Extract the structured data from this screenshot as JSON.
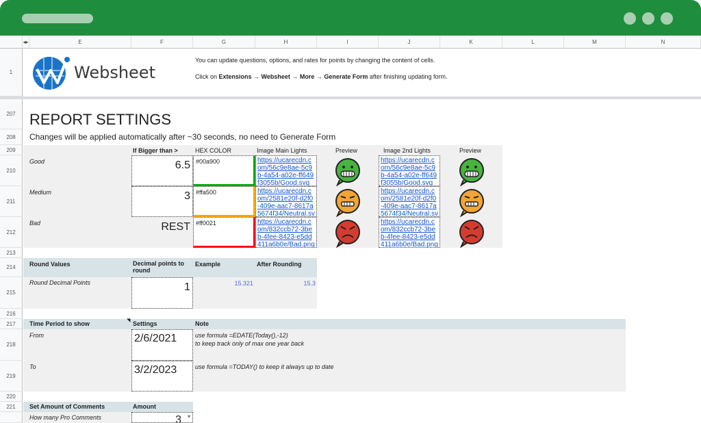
{
  "columns": [
    "E",
    "F",
    "G",
    "H",
    "I",
    "J",
    "K",
    "L",
    "M",
    "N"
  ],
  "rows": [
    "1",
    "207",
    "208",
    "209",
    "210",
    "211",
    "212",
    "213",
    "214",
    "215",
    "216",
    "217",
    "218",
    "219",
    "220",
    "221"
  ],
  "brand": "Websheet",
  "info": {
    "line1": "You can update questions, options, and rates for points by changing the content of cells.",
    "line2_prefix": "Click on ",
    "line2_bold": "Extensions → Websheet → More → Generate Form",
    "line2_suffix": " after finishing updating form."
  },
  "report": {
    "title": "REPORT SETTINGS",
    "subtitle": "Changes will be applied automatically after ~30 seconds, no need to Generate Form"
  },
  "thresholds": {
    "headers": {
      "bigger": "If Bigger than >",
      "hex": "HEX COLOR",
      "main": "Image Main Lights",
      "preview": "Preview",
      "second": "Image 2nd Lights",
      "preview2": "Preview"
    },
    "rows": [
      {
        "label": "Good",
        "value": "6.5",
        "hex": "#00a900",
        "color": "#00a900",
        "main_link": "https://ucarecdn.com/56c9e8ae-5c9b-4a54-a02e-ff649f3055b/Good.svg",
        "second_link": "https://ucarecdn.com/56c9e8ae-5c9b-4a54-a02e-ff649f3055b/Good.svg",
        "face": "happy-face-icon",
        "face_color": "#49b340"
      },
      {
        "label": "Medium",
        "value": "3",
        "hex": "#ffa500",
        "color": "#ffa500",
        "main_link": "https://ucarecdn.com/2581e20f-d2f0-409e-aac7-8617a5674f34/Neutral.svg",
        "second_link": "https://ucarecdn.com/2581e20f-d2f0-409e-aac7-8617a5674f34/Neutral.svg",
        "face": "neutral-face-icon",
        "face_color": "#f3a533"
      },
      {
        "label": "Bad",
        "value": "REST",
        "hex": "#ff0021",
        "color": "#ff0021",
        "main_link": "https://ucarecdn.com/832ccb72-3be b-4fee-8423-e5dd411a6b0e/Bad.png",
        "second_link": "https://ucarecdn.com/832ccb72-3be b-4fee-8423-e5dd411a6b0e/Bad.png",
        "face": "angry-face-icon",
        "face_color": "#d63b2f"
      }
    ]
  },
  "round": {
    "header": "Round Values",
    "decimal_header": "Decimal points to round",
    "example_header": "Example",
    "after_header": "After Rounding",
    "label": "Round Decimal Points",
    "value": "1",
    "example": "15.321",
    "after": "15.3"
  },
  "period": {
    "header": "Time Period to show",
    "settings_header": "Settings",
    "note_header": "Note",
    "from_label": "From",
    "from_value": "2/6/2021",
    "from_note1": "use formula =EDATE(Today(),-12)",
    "from_note2": "to keep track only of max one year back",
    "to_label": "To",
    "to_value": "3/2/2023",
    "to_note": "use formula =TODAY() to keep it always up to date"
  },
  "comments": {
    "header": "Set Amount of Comments",
    "amount_header": "Amount",
    "label": "How many Pro Comments",
    "value": "3"
  }
}
